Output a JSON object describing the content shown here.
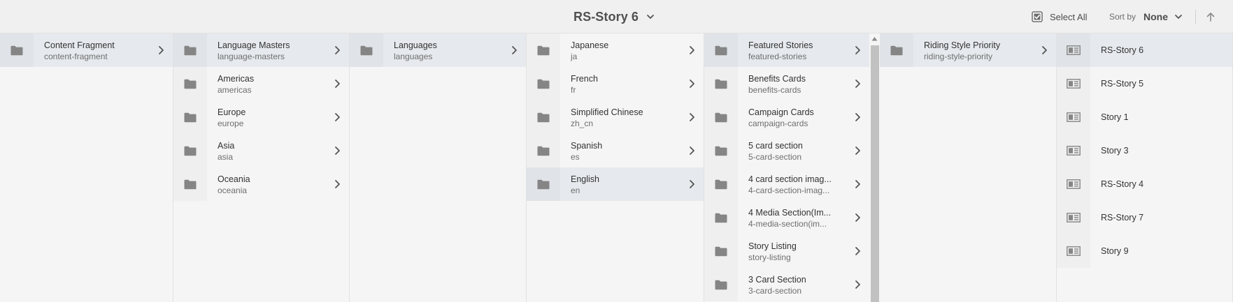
{
  "header": {
    "title": "RS-Story 6",
    "select_all_label": "Select All",
    "sort_by_label": "Sort by",
    "sort_value": "None"
  },
  "icons": {
    "folder": "folder-icon",
    "fragment": "content-fragment-icon",
    "chevron_right": "chevron-right-icon",
    "chevron_down": "chevron-down-icon",
    "checkbox": "checkbox-icon",
    "up_arrow": "arrow-up-icon"
  },
  "colors": {
    "selected_row": "#e6e9ed",
    "icon_gray": "#8a8a8a",
    "scroll_thumb": "#c1c1c1"
  },
  "columns": [
    {
      "items": [
        {
          "title": "Content Fragment",
          "subtitle": "content-fragment",
          "selected": true
        }
      ]
    },
    {
      "items": [
        {
          "title": "Language Masters",
          "subtitle": "language-masters",
          "selected": true
        },
        {
          "title": "Americas",
          "subtitle": "americas"
        },
        {
          "title": "Europe",
          "subtitle": "europe"
        },
        {
          "title": "Asia",
          "subtitle": "asia"
        },
        {
          "title": "Oceania",
          "subtitle": "oceania"
        }
      ]
    },
    {
      "items": [
        {
          "title": "Languages",
          "subtitle": "languages",
          "selected": true
        }
      ]
    },
    {
      "items": [
        {
          "title": "Japanese",
          "subtitle": "ja"
        },
        {
          "title": "French",
          "subtitle": "fr"
        },
        {
          "title": "Simplified Chinese",
          "subtitle": "zh_cn"
        },
        {
          "title": "Spanish",
          "subtitle": "es"
        },
        {
          "title": "English",
          "subtitle": "en",
          "selected": true
        }
      ]
    },
    {
      "items": [
        {
          "title": "Featured Stories",
          "subtitle": "featured-stories",
          "selected": true
        },
        {
          "title": "Benefits Cards",
          "subtitle": "benefits-cards"
        },
        {
          "title": "Campaign Cards",
          "subtitle": "campaign-cards"
        },
        {
          "title": "5 card section",
          "subtitle": "5-card-section"
        },
        {
          "title": "4 card section imag...",
          "subtitle": "4-card-section-imag..."
        },
        {
          "title": "4 Media Section(Im...",
          "subtitle": "4-media-section(im..."
        },
        {
          "title": "Story Listing",
          "subtitle": "story-listing"
        },
        {
          "title": "3 Card Section",
          "subtitle": "3-card-section"
        }
      ]
    },
    {
      "items": [
        {
          "title": "Riding Style Priority",
          "subtitle": "riding-style-priority",
          "selected": true
        }
      ]
    },
    {
      "items": [
        {
          "title": "RS-Story 6",
          "selected": true
        },
        {
          "title": "RS-Story 5"
        },
        {
          "title": "Story 1"
        },
        {
          "title": "Story 3"
        },
        {
          "title": "RS-Story 4"
        },
        {
          "title": "RS-Story 7"
        },
        {
          "title": "Story 9"
        }
      ]
    }
  ]
}
